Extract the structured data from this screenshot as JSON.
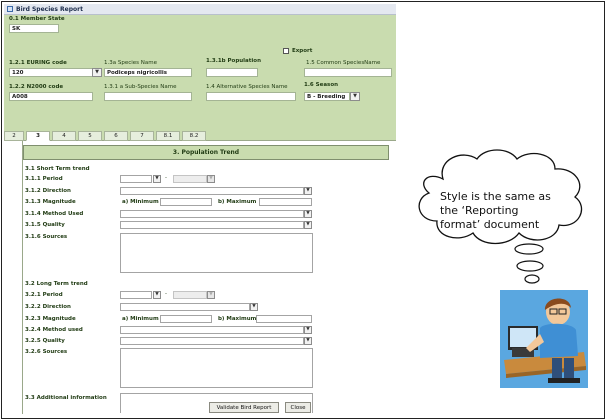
{
  "window": {
    "title": "Bird Species Report"
  },
  "header": {
    "member_state_label": "0.1 Member State",
    "member_state_value": "SK",
    "export_label": "Export",
    "euring_label": "1.2.1 EURING code",
    "euring_value": "120",
    "species_name_label": "1.3a Species Name",
    "species_name_value": "Podiceps nigricollis",
    "population_label": "1.3.1b Population",
    "population_value": "",
    "common_name_label": "1.5 Common SpeciesName",
    "common_name_value": "",
    "n2000_label": "1.2.2 N2000 code",
    "n2000_value": "A008",
    "subspecies_label": "1.3.1 a Sub-Species Name",
    "subspecies_value": "",
    "alt_name_label": "1.4 Alternative Species Name",
    "alt_name_value": "",
    "season_label": "1.6 Season",
    "season_value": "B - Breeding"
  },
  "tabs": [
    {
      "label": "2"
    },
    {
      "label": "3"
    },
    {
      "label": "4"
    },
    {
      "label": "5"
    },
    {
      "label": "6"
    },
    {
      "label": "7"
    },
    {
      "label": "8.1"
    },
    {
      "label": "8.2"
    }
  ],
  "section": {
    "title": "3. Population Trend",
    "short_term": {
      "heading": "3.1 Short Term trend",
      "period_label": "3.1.1 Period",
      "period_sep": "-",
      "direction_label": "3.1.2 Direction",
      "magnitude_label": "3.1.3 Magnitude",
      "min_label": "a) Minimum",
      "max_label": "b) Maximum",
      "method_label": "3.1.4 Method Used",
      "quality_label": "3.1.5 Quality",
      "sources_label": "3.1.6 Sources"
    },
    "long_term": {
      "heading": "3.2 Long Term trend",
      "period_label": "3.2.1 Period",
      "period_sep": "-",
      "direction_label": "3.2.2 Direction",
      "magnitude_label": "3.2.3 Magnitude",
      "min_label": "a) Minimum",
      "max_label": "b) Maximum",
      "method_label": "3.2.4 Method used",
      "quality_label": "3.2.5 Quality",
      "sources_label": "3.2.6 Sources"
    },
    "additional_label": "3.3 Additional information"
  },
  "buttons": {
    "validate": "Validate Bird Report",
    "close": "Close"
  },
  "callout": {
    "line1": "Style is the same as",
    "line2": "the  ‘Reporting",
    "line3": "format’ document"
  },
  "icons": {
    "dropdown": "chevron-down-icon",
    "window": "window-icon"
  },
  "colors": {
    "header_bg": "#c9dcaf",
    "label": "#1f3a12"
  }
}
